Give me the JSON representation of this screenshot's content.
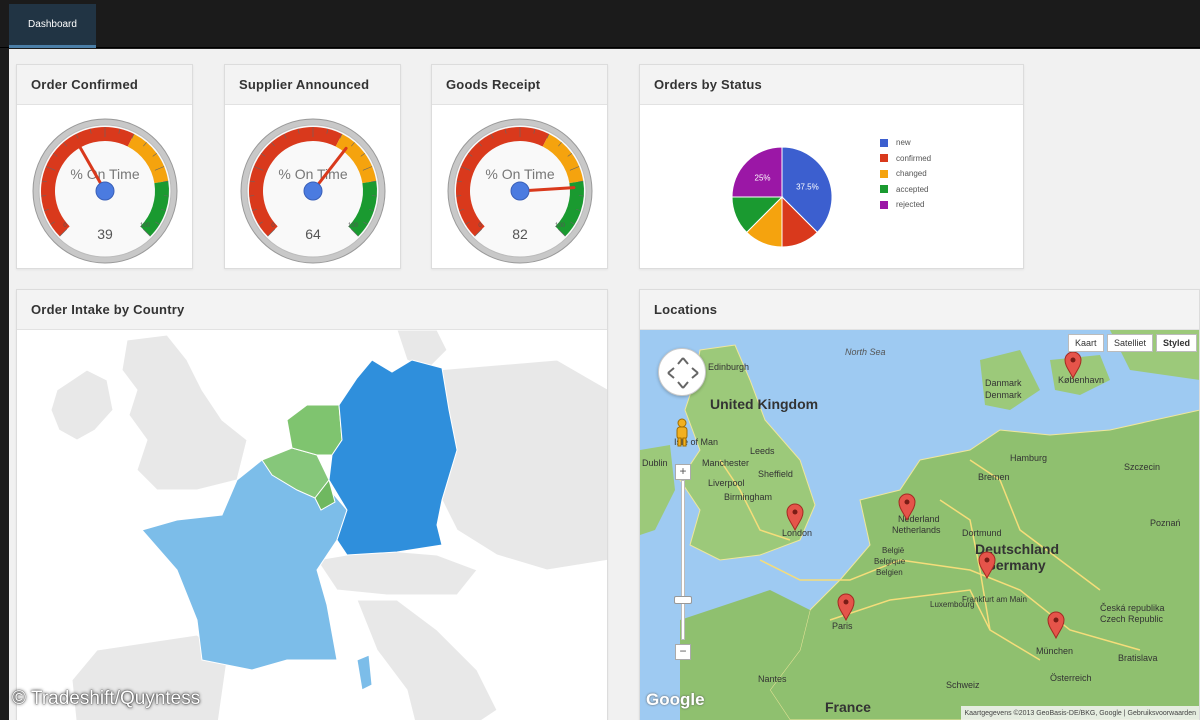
{
  "nav": {
    "tab_dashboard": "Dashboard"
  },
  "gauges": [
    {
      "title": "Order Confirmed",
      "label": "% On Time",
      "value": 39,
      "min": "0",
      "max": "100",
      "display": "39"
    },
    {
      "title": "Supplier Announced",
      "label": "% On Time",
      "value": 64,
      "min": "0",
      "max": "100",
      "display": "64"
    },
    {
      "title": "Goods Receipt",
      "label": "% On Time",
      "value": 82,
      "min": "0",
      "max": "100",
      "display": "82"
    }
  ],
  "orders_by_status": {
    "title": "Orders by Status",
    "legend": [
      {
        "label": "new",
        "color": "#3c5fcf"
      },
      {
        "label": "confirmed",
        "color": "#d9391c"
      },
      {
        "label": "changed",
        "color": "#f5a30e"
      },
      {
        "label": "accepted",
        "color": "#1a9a30"
      },
      {
        "label": "rejected",
        "color": "#9b17a6"
      }
    ]
  },
  "chart_data": {
    "type": "pie",
    "categories": [
      "new",
      "confirmed",
      "changed",
      "accepted",
      "rejected"
    ],
    "values": [
      37.5,
      12.5,
      12.5,
      12.5,
      25
    ],
    "slice_labels": [
      "37.5%",
      "",
      "",
      "",
      "25%"
    ],
    "colors": [
      "#3c5fcf",
      "#d9391c",
      "#f5a30e",
      "#1a9a30",
      "#9b17a6"
    ],
    "legend_position": "right"
  },
  "order_intake": {
    "title": "Order Intake by Country",
    "colors": {
      "germany": "#2f8fdc",
      "france": "#7cbde9",
      "netherlands": "#7fc46f",
      "belgium": "#86c77a",
      "luxembourg": "#6fb860",
      "land": "#e8e8e8",
      "sea": "#ffffff"
    }
  },
  "locations": {
    "title": "Locations",
    "map_types": [
      "Kaart",
      "Satelliet",
      "Styled"
    ],
    "places": [
      "North Sea",
      "United Kingdom",
      "Deutschland",
      "Germany",
      "France",
      "Danmark",
      "Denmark",
      "Nederland",
      "Netherlands",
      "België",
      "Belgique",
      "Belgien",
      "Luxembourg",
      "Edinburgh",
      "Leeds",
      "Manchester",
      "Liverpool",
      "Birmingham",
      "Sheffield",
      "London",
      "Paris",
      "Hamburg",
      "Bremen",
      "Dortmund",
      "Frankfurt am Main",
      "München",
      "København",
      "Szczecin",
      "Poznań",
      "Česká republika",
      "Czech Republic",
      "Schweiz",
      "Österreich",
      "Bratislava",
      "Dublin",
      "Isle of Man",
      "Nantes"
    ],
    "footer": "Kaartgegevens ©2013 GeoBasis-DE/BKG, Google | Gebruiksvoorwaarden"
  },
  "watermark": "© Tradeshift/Quyntess"
}
